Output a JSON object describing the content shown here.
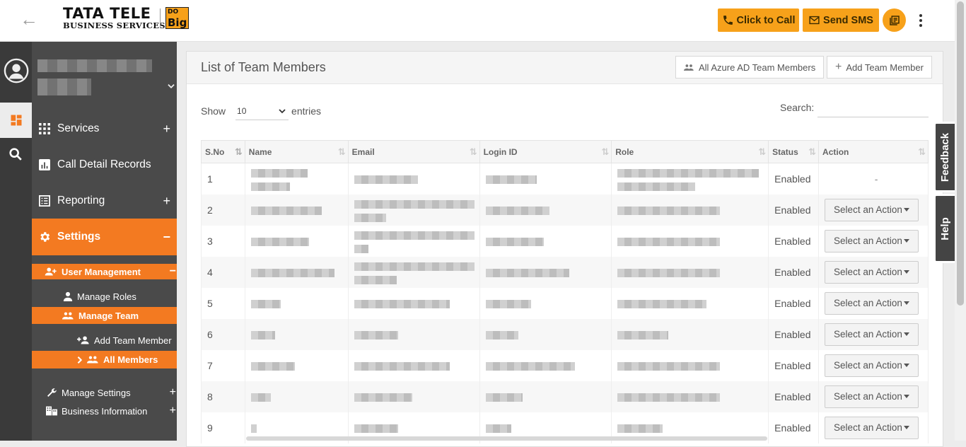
{
  "brand": {
    "line1": "TATA TELE",
    "line2": "BUSINESS SERVICES",
    "badge_top": "DO",
    "badge_bottom": "Big"
  },
  "topbar": {
    "call_label": "Click to Call",
    "sms_label": "Send SMS"
  },
  "sidebar": {
    "nav": [
      {
        "label": "Services",
        "expand": "+"
      },
      {
        "label": "Call Detail Records",
        "expand": ""
      },
      {
        "label": "Reporting",
        "expand": "+"
      },
      {
        "label": "Settings",
        "expand": "−"
      }
    ],
    "user_management": {
      "label": "User Management",
      "expand": "−"
    },
    "manage_roles": "Manage Roles",
    "manage_team": "Manage Team",
    "add_team_member": "Add Team Member",
    "all_members": "All Members",
    "manage_settings": {
      "label": "Manage Settings",
      "expand": "+"
    },
    "business_information": {
      "label": "Business Information",
      "expand": "+"
    }
  },
  "main": {
    "title": "List of Team Members",
    "azure_button": "All Azure AD Team Members",
    "add_button": "Add Team Member",
    "show_label": "Show",
    "entries_value": "10",
    "entries_label": "entries",
    "search_label": "Search:",
    "columns": [
      "S.No",
      "Name",
      "Email",
      "Login ID",
      "Role",
      "Status",
      "Action"
    ],
    "rows": [
      {
        "sno": "1",
        "status": "Enabled",
        "action": "-"
      },
      {
        "sno": "2",
        "status": "Enabled",
        "action": "Select an Action"
      },
      {
        "sno": "3",
        "status": "Enabled",
        "action": "Select an Action"
      },
      {
        "sno": "4",
        "status": "Enabled",
        "action": "Select an Action"
      },
      {
        "sno": "5",
        "status": "Enabled",
        "action": "Select an Action"
      },
      {
        "sno": "6",
        "status": "Enabled",
        "action": "Select an Action"
      },
      {
        "sno": "7",
        "status": "Enabled",
        "action": "Select an Action"
      },
      {
        "sno": "8",
        "status": "Enabled",
        "action": "Select an Action"
      },
      {
        "sno": "9",
        "status": "Enabled",
        "action": "Select an Action"
      }
    ]
  },
  "side_tabs": {
    "feedback": "Feedback",
    "help": "Help"
  },
  "colors": {
    "accent": "#f7a11a",
    "nav_active": "#f37a21",
    "sidebar_bg": "#4a4a4a",
    "rail_bg": "#3a3a3a"
  }
}
